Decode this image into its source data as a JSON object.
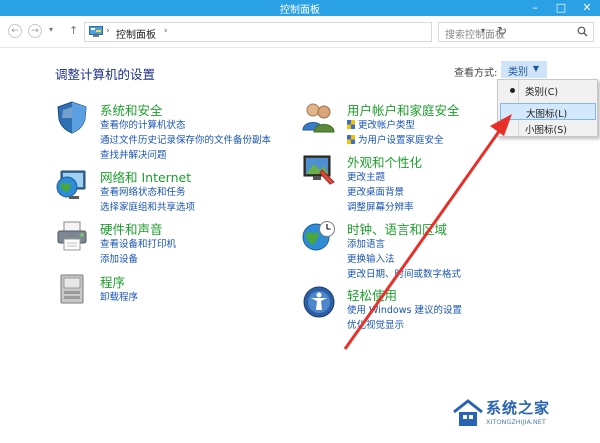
{
  "window": {
    "title": "控制面板"
  },
  "address": {
    "path": "控制面板"
  },
  "search": {
    "placeholder": "搜索控制面板"
  },
  "content": {
    "heading": "调整计算机的设置"
  },
  "view_by": {
    "label": "查看方式:",
    "value": "类别"
  },
  "view_menu": {
    "items": [
      {
        "label": "类别(C)",
        "selected": true
      },
      {
        "label": "大图标(L)",
        "highlighted": true
      },
      {
        "label": "小图标(S)"
      }
    ]
  },
  "categories": [
    {
      "title": "系统和安全",
      "links": [
        "查看你的计算机状态",
        "通过文件历史记录保存你的文件备份副本",
        "查找并解决问题"
      ]
    },
    {
      "title": "网络和 Internet",
      "links": [
        "查看网络状态和任务",
        "选择家庭组和共享选项"
      ]
    },
    {
      "title": "硬件和声音",
      "links": [
        "查看设备和打印机",
        "添加设备"
      ]
    },
    {
      "title": "程序",
      "links": [
        "卸载程序"
      ]
    },
    {
      "title": "用户帐户和家庭安全",
      "links": [
        "更改帐户类型",
        "为用户设置家庭安全"
      ]
    },
    {
      "title": "外观和个性化",
      "links": [
        "更改主题",
        "更改桌面背景",
        "调整屏幕分辨率"
      ]
    },
    {
      "title": "时钟、语言和区域",
      "links": [
        "添加语言",
        "更换输入法",
        "更改日期、时间或数字格式"
      ]
    },
    {
      "title": "轻松使用",
      "links": [
        "使用 Windows 建议的设置",
        "优化视觉显示"
      ]
    }
  ],
  "watermark": {
    "text": "系统之家",
    "url": "XITONGZHIJIA.NET"
  },
  "colors": {
    "titlebar": "#2aa0e5",
    "category_title": "#1e9e2e",
    "link": "#1a55b7",
    "heading": "#1e3287",
    "arrow": "#e8302a"
  }
}
